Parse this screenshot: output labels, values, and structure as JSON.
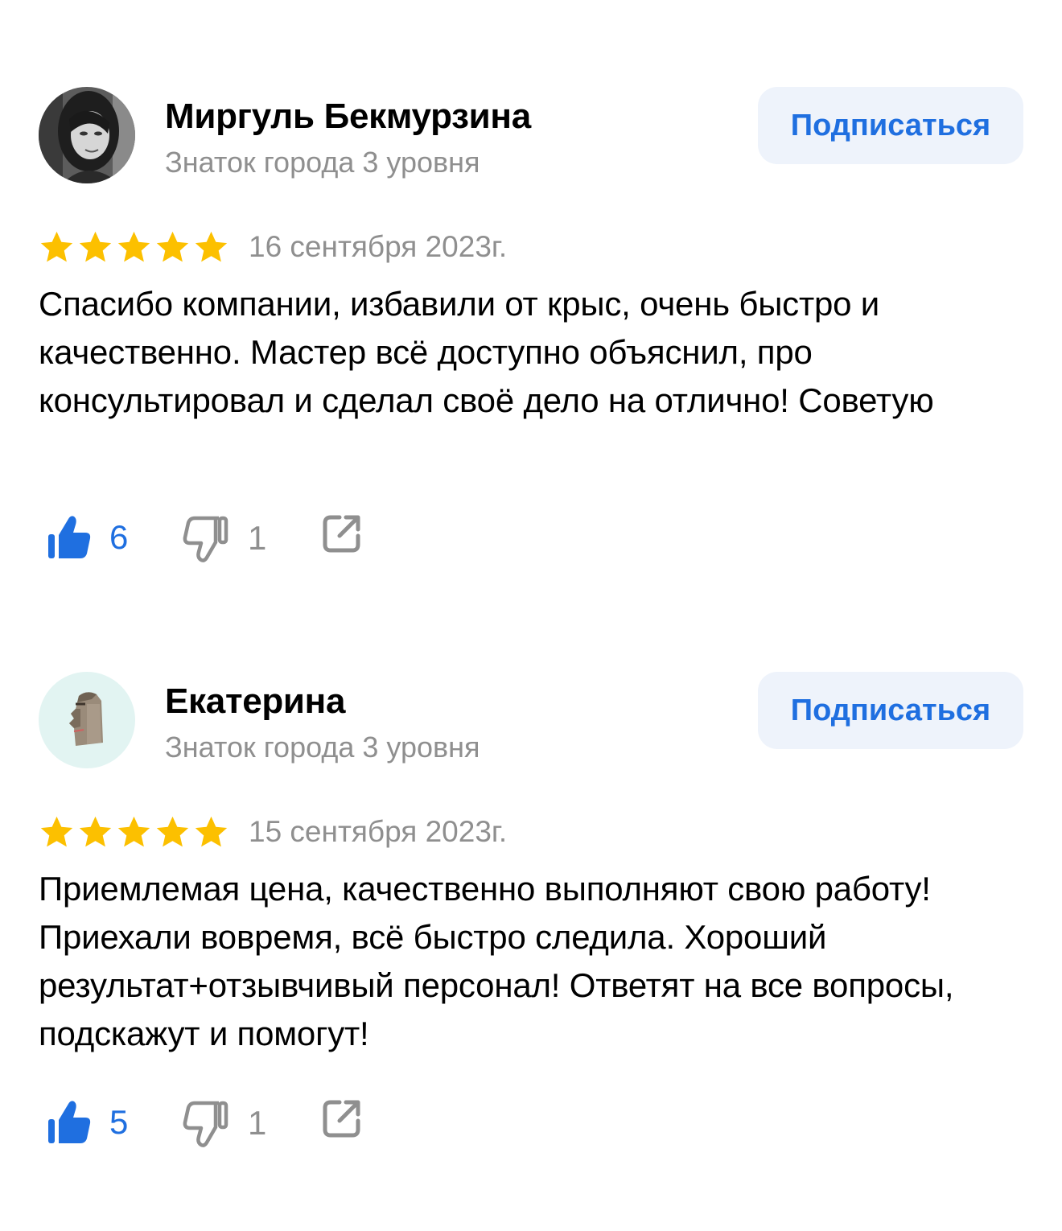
{
  "colors": {
    "accent": "#1f6fe0",
    "star": "#fcc000",
    "muted": "#8f8f8f",
    "button_bg": "#eef3fb"
  },
  "reviews": [
    {
      "author": "Миргуль Бекмурзина",
      "level": "Знаток города 3 уровня",
      "subscribe_label": "Подписаться",
      "rating": 5,
      "date": "16 сентября 2023г.",
      "text": "Спасибо компании, избавили от крыс, очень быстро и качественно. Мастер всё доступно объяснил, про консультировал и сделал своё дело на отлично! Советую",
      "likes": "6",
      "dislikes": "1",
      "avatar_icon": "user-photo-avatar"
    },
    {
      "author": "Екатерина",
      "level": "Знаток города 3 уровня",
      "subscribe_label": "Подписаться",
      "rating": 5,
      "date": "15 сентября 2023г.",
      "text": "Приемлемая цена, качественно выполняют свою работу! Приехали вовремя, всё быстро следила. Хороший результат+отзывчивый персонал! Ответят на все вопросы, подскажут и помогут!",
      "likes": "5",
      "dislikes": "1",
      "avatar_icon": "moai-statue-avatar"
    }
  ]
}
